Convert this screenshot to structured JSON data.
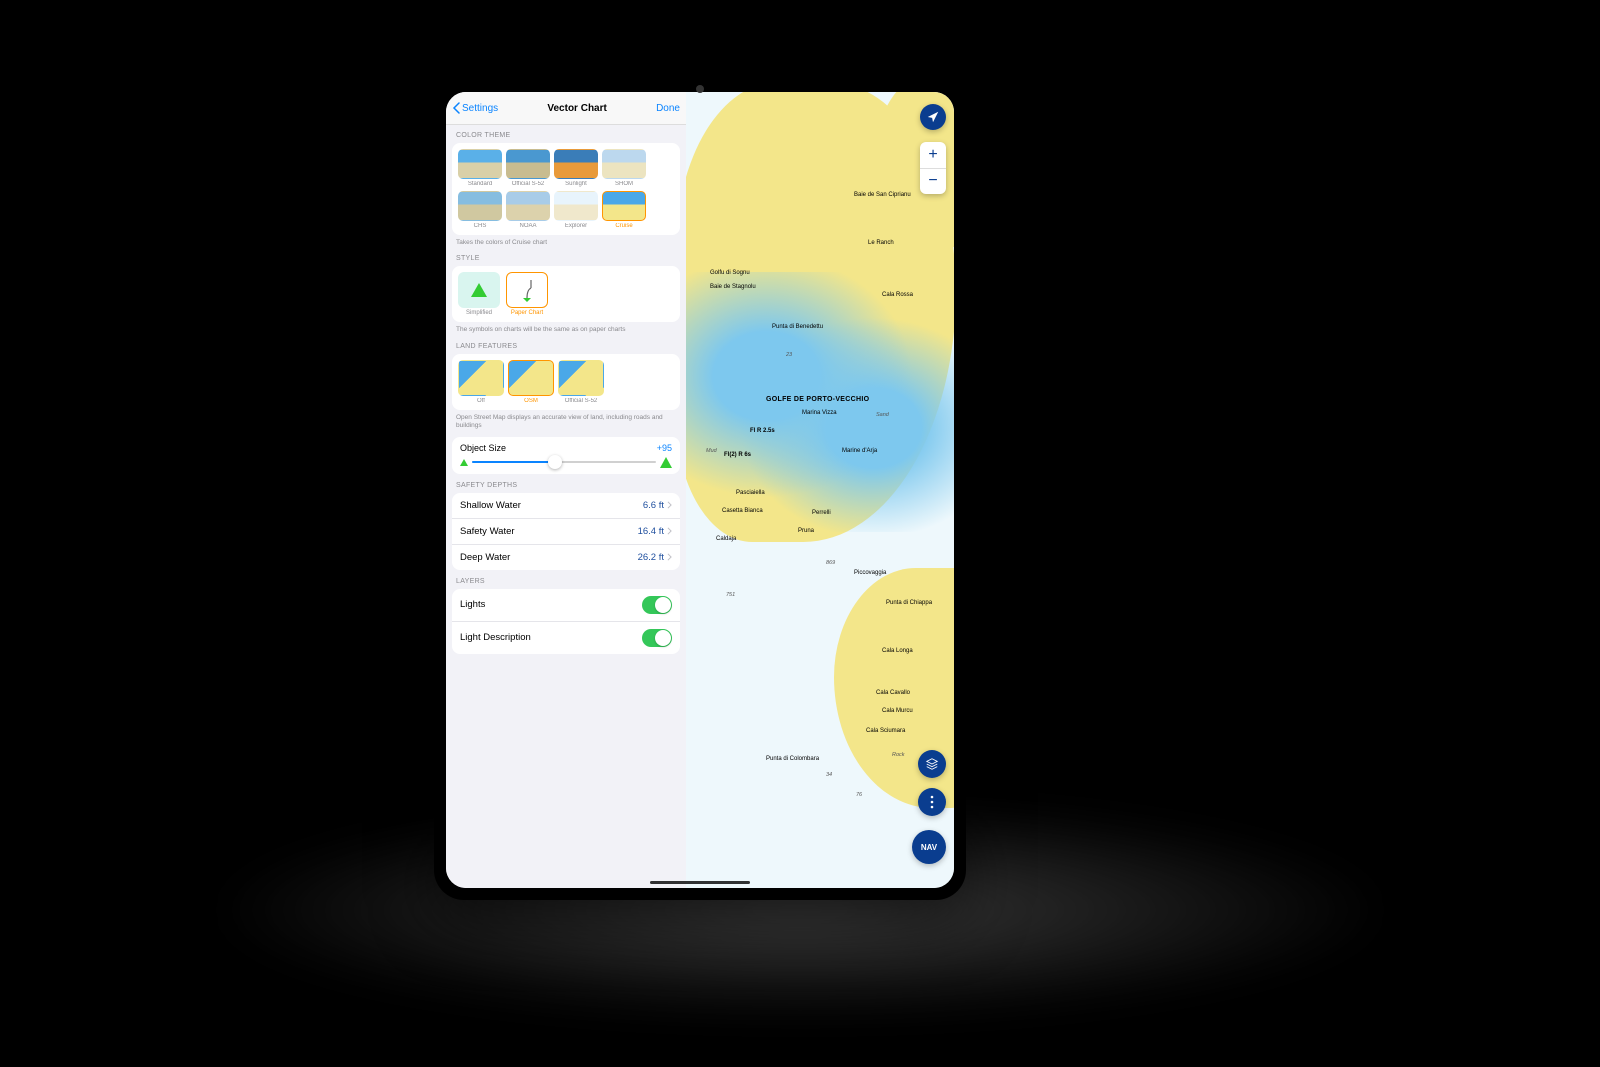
{
  "nav": {
    "back": "Settings",
    "title": "Vector Chart",
    "done": "Done"
  },
  "sections": {
    "colorTheme": {
      "header": "COLOR THEME",
      "items": [
        "Standard",
        "Official S-52",
        "Sunlight",
        "SHOM",
        "CHS",
        "NOAA",
        "Explorer",
        "Cruise"
      ],
      "selected": "Cruise",
      "hint": "Takes the colors of Cruise chart"
    },
    "style": {
      "header": "STYLE",
      "items": [
        "Simplified",
        "Paper Chart"
      ],
      "selected": "Paper Chart",
      "hint": "The symbols on charts will be the same as on paper charts"
    },
    "landFeatures": {
      "header": "LAND FEATURES",
      "items": [
        "Off",
        "OSM",
        "Official S-52"
      ],
      "selected": "OSM",
      "hint": "Open Street Map displays an accurate view of land, including roads and buildings"
    },
    "objectSize": {
      "label": "Object Size",
      "value": "+95"
    },
    "safetyDepths": {
      "header": "SAFETY DEPTHS",
      "rows": [
        {
          "label": "Shallow Water",
          "value": "6.6 ft"
        },
        {
          "label": "Safety Water",
          "value": "16.4 ft"
        },
        {
          "label": "Deep Water",
          "value": "26.2 ft"
        }
      ]
    },
    "layers": {
      "header": "LAYERS",
      "rows": [
        {
          "label": "Lights",
          "on": true
        },
        {
          "label": "Light Description",
          "on": true
        }
      ]
    }
  },
  "map": {
    "navLabel": "NAV",
    "labels": {
      "gulf": "GOLFE DE PORTO-VECCHIO",
      "l1": "Golfu di Sognu",
      "l2": "Baie de Stagnolu",
      "l3": "Punta di Benedettu",
      "l4": "Marina Vizza",
      "l5": "Fl R 2.5s",
      "l6": "Fl(2) R 6s",
      "l7": "Marine d'Arja",
      "l8": "Pasciaiella",
      "l9": "Casetta Bianca",
      "l10": "Caldaja",
      "l11": "Pruna",
      "l12": "Perrelli",
      "l13": "Piccovaggia",
      "l14": "Punta di Chiappa",
      "l15": "Cala Rossa",
      "l16": "Cala Longa",
      "l17": "Cala Cavallo",
      "l18": "Cala Murcu",
      "l19": "Cala Sciumara",
      "l20": "Punta di Colombara",
      "l21": "Baie de San Ciprianu",
      "l22": "Le Ranch",
      "d1": "869",
      "d2": "751",
      "d3": "76",
      "d4": "34",
      "d5": "Sand",
      "d6": "Rock",
      "d7": "Mud",
      "d8": "23"
    }
  }
}
